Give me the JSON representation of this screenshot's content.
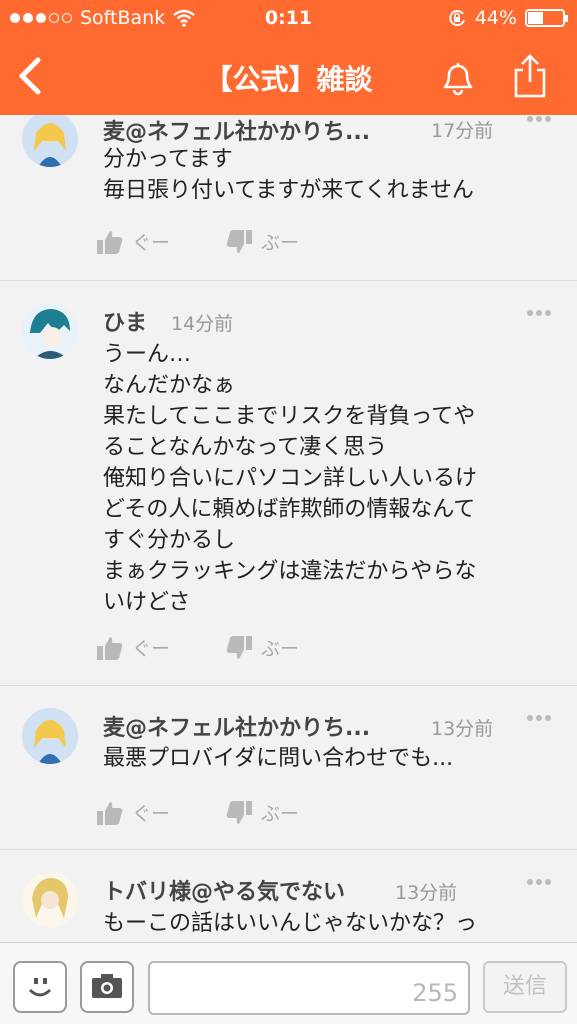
{
  "status_bar": {
    "carrier": "SoftBank",
    "time": "0:11",
    "battery": "44%",
    "battery_level": 0.44
  },
  "nav": {
    "title": "【公式】雑談"
  },
  "posts": [
    {
      "author": "麦@ネフェル社かかりち...",
      "time": "17分前",
      "lines": [
        "分かってます",
        "毎日張り付いてますが来てくれません"
      ],
      "good_label": "ぐー",
      "boo_label": "ぶー"
    },
    {
      "author": "ひま",
      "time": "14分前",
      "lines": [
        "うーん…",
        "なんだかなぁ",
        "果たしてここまでリスクを背負ってや",
        "ることなんかなって凄く思う",
        "俺知り合いにパソコン詳しい人いるけ",
        "どその人に頼めば詐欺師の情報なんて",
        "すぐ分かるし",
        "まぁクラッキングは違法だからやらな",
        "いけどさ"
      ],
      "good_label": "ぐー",
      "boo_label": "ぶー"
    },
    {
      "author": "麦@ネフェル社かかりち...",
      "time": "13分前",
      "lines": [
        "最悪プロバイダに問い合わせでも..."
      ],
      "good_label": "ぐー",
      "boo_label": "ぶー"
    },
    {
      "author": "トバリ様@やる気でない",
      "time": "13分前",
      "lines": [
        "もーこの話はいいんじゃないかな？っ"
      ]
    }
  ],
  "input_bar": {
    "char_count": "255",
    "send_label": "送信"
  },
  "colors": {
    "accent": "#ff6a30",
    "background": "#f2f2f2"
  }
}
